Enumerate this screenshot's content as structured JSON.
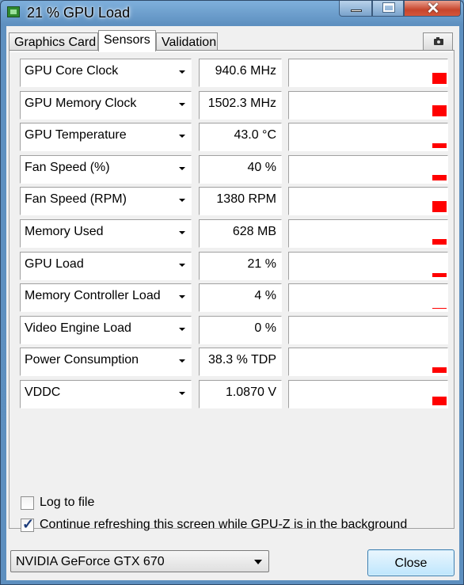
{
  "window": {
    "title": "21 % GPU Load",
    "minimize_icon": "minimize-icon",
    "maximize_icon": "maximize-icon",
    "close_icon": "close-icon",
    "close_glyph": "✕"
  },
  "tabs": [
    {
      "label": "Graphics Card"
    },
    {
      "label": "Sensors",
      "active": true
    },
    {
      "label": "Validation"
    }
  ],
  "camera_icon": "camera-icon",
  "sensors": [
    {
      "name": "GPU Core Clock",
      "value": "940.6 MHz",
      "level": 0.6
    },
    {
      "name": "GPU Memory Clock",
      "value": "1502.3 MHz",
      "level": 0.6
    },
    {
      "name": "GPU Temperature",
      "value": "43.0 °C",
      "level": 0.25
    },
    {
      "name": "Fan Speed (%)",
      "value": "40 %",
      "level": 0.3
    },
    {
      "name": "Fan Speed (RPM)",
      "value": "1380 RPM",
      "level": 0.6
    },
    {
      "name": "Memory Used",
      "value": "628 MB",
      "level": 0.3
    },
    {
      "name": "GPU Load",
      "value": "21 %",
      "level": 0.21
    },
    {
      "name": "Memory Controller Load",
      "value": "4 %",
      "level": 0.04
    },
    {
      "name": "Video Engine Load",
      "value": "0 %",
      "level": 0
    },
    {
      "name": "Power Consumption",
      "value": "38.3 % TDP",
      "level": 0.3
    },
    {
      "name": "VDDC",
      "value": "1.0870 V",
      "level": 0.45
    }
  ],
  "graph_color": "#ff0000",
  "options": {
    "log_to_file": {
      "label": "Log to file",
      "checked": false
    },
    "continue_refreshing": {
      "label": "Continue refreshing this screen while GPU-Z is in the background",
      "checked": true
    }
  },
  "gpu_selector": {
    "selected": "NVIDIA GeForce GTX 670"
  },
  "close_button": {
    "label": "Close"
  }
}
